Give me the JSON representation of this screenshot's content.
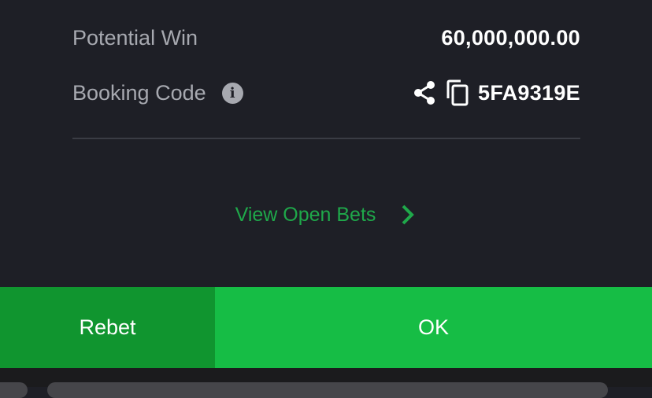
{
  "summary": {
    "potential_win_label": "Potential Win",
    "potential_win_value": "60,000,000.00",
    "booking_code_label": "Booking Code",
    "booking_code_value": "5FA9319E",
    "info_icon_glyph": "i"
  },
  "links": {
    "view_open_bets": "View Open Bets"
  },
  "buttons": {
    "rebet": "Rebet",
    "ok": "OK"
  },
  "icons": [
    "info-icon",
    "share-icon",
    "copy-icon",
    "chevron-right-icon"
  ],
  "colors": {
    "background": "#1e1f26",
    "accent_green": "#1fa84a",
    "rebet_button": "#10952f",
    "ok_button": "#16bd45"
  }
}
